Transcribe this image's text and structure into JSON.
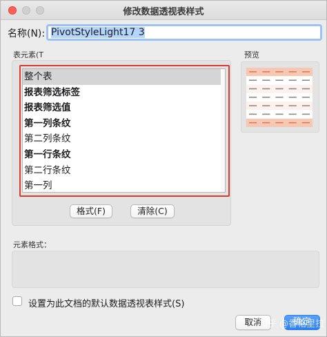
{
  "window": {
    "title": "修改数据透视表样式"
  },
  "name": {
    "label": "名称(N):",
    "value": "PivotStyleLight17 3"
  },
  "table_elements": {
    "label": "表元素(T",
    "items": [
      {
        "label": "整个表",
        "bold": false,
        "selected": true
      },
      {
        "label": "报表筛选标签",
        "bold": true,
        "selected": false
      },
      {
        "label": "报表筛选值",
        "bold": true,
        "selected": false
      },
      {
        "label": "第一列条纹",
        "bold": true,
        "selected": false
      },
      {
        "label": "第二列条纹",
        "bold": false,
        "selected": false
      },
      {
        "label": "第一行条纹",
        "bold": true,
        "selected": false
      },
      {
        "label": "第二行条纹",
        "bold": false,
        "selected": false
      },
      {
        "label": "第一列",
        "bold": false,
        "selected": false
      }
    ]
  },
  "buttons": {
    "format": "格式(F)",
    "clear": "清除(C)",
    "cancel": "取消",
    "ok": "确定"
  },
  "preview": {
    "label": "预览",
    "header_color": "#f4c8b4",
    "band_color": "#fcf1ec"
  },
  "element_format": {
    "label": "元素格式："
  },
  "default_checkbox": {
    "label": "设置为此文档的默认数据透视表样式(S)",
    "checked": false
  },
  "watermark": {
    "text": "知乎 @香格里拉"
  },
  "colors": {
    "accent": "#2c7ef0",
    "highlight_border": "#d93a2b",
    "selection": "#d5d5d5"
  }
}
